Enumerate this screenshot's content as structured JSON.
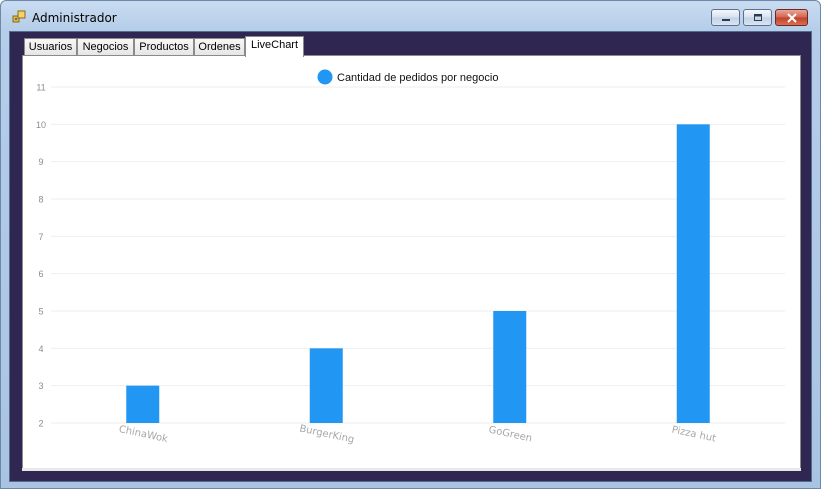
{
  "window": {
    "title": "Administrador"
  },
  "tabs": [
    {
      "label": "Usuarios"
    },
    {
      "label": "Negocios"
    },
    {
      "label": "Productos"
    },
    {
      "label": "Ordenes"
    },
    {
      "label": "LiveChart",
      "active": true
    }
  ],
  "colors": {
    "series": "#2196f3",
    "client_bg": "#2f2651"
  },
  "chart_data": {
    "type": "bar",
    "title": "",
    "categories": [
      "ChinaWok",
      "BurgerKing",
      "GoGreen",
      "Pizza hut"
    ],
    "series": [
      {
        "name": "Cantidad de pedidos por negocio",
        "values": [
          3,
          4,
          5,
          10
        ]
      }
    ],
    "xlabel": "",
    "ylabel": "",
    "ylim": [
      2,
      11
    ],
    "yticks": [
      "2",
      "3",
      "4",
      "5",
      "6",
      "7",
      "8",
      "9",
      "10",
      "11"
    ],
    "grid": true,
    "legend": "top-center"
  }
}
